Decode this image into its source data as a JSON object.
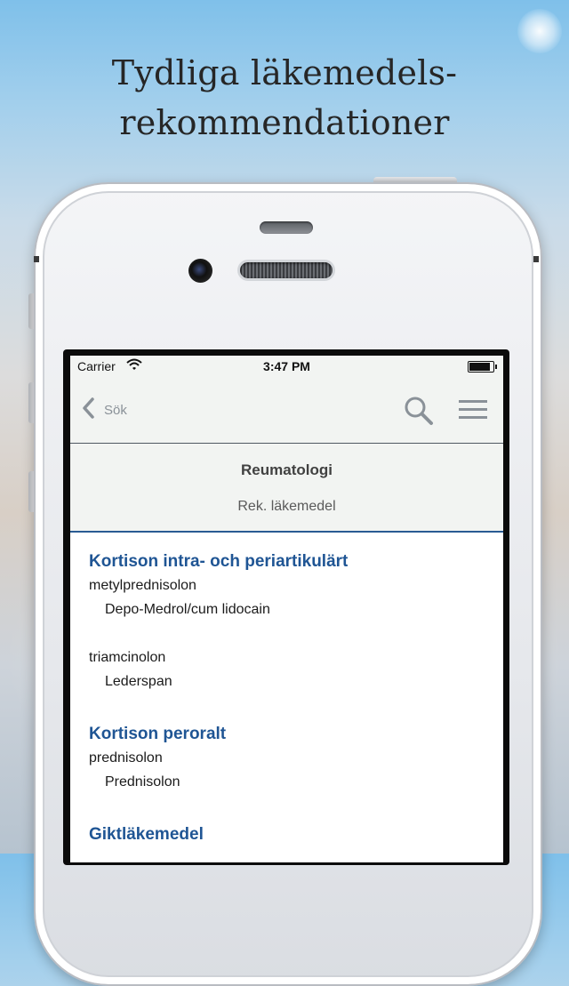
{
  "headline": {
    "line1": "Tydliga läkemedels-",
    "line2": "rekommendationer"
  },
  "statusbar": {
    "carrier": "Carrier",
    "time": "3:47 PM",
    "battery_level": 0.9
  },
  "navbar": {
    "back_label": "Sök",
    "icons": [
      "chevron-left-icon",
      "search-icon",
      "hamburger-menu-icon"
    ]
  },
  "subheader": {
    "title": "Reumatologi",
    "tab": "Rek. läkemedel"
  },
  "sections": [
    {
      "heading": "Kortison intra- och periartikulärt",
      "items": [
        {
          "substance": "metylprednisolon",
          "product": "Depo-Medrol/cum lidocain"
        },
        {
          "substance": "triamcinolon",
          "product": "Lederspan"
        }
      ]
    },
    {
      "heading": "Kortison peroralt",
      "items": [
        {
          "substance": "prednisolon",
          "product": "Prednisolon"
        }
      ]
    },
    {
      "heading": "Giktläkemedel",
      "items": []
    }
  ],
  "colors": {
    "accent": "#1f5594",
    "bar_bg": "#f2f4f2"
  }
}
